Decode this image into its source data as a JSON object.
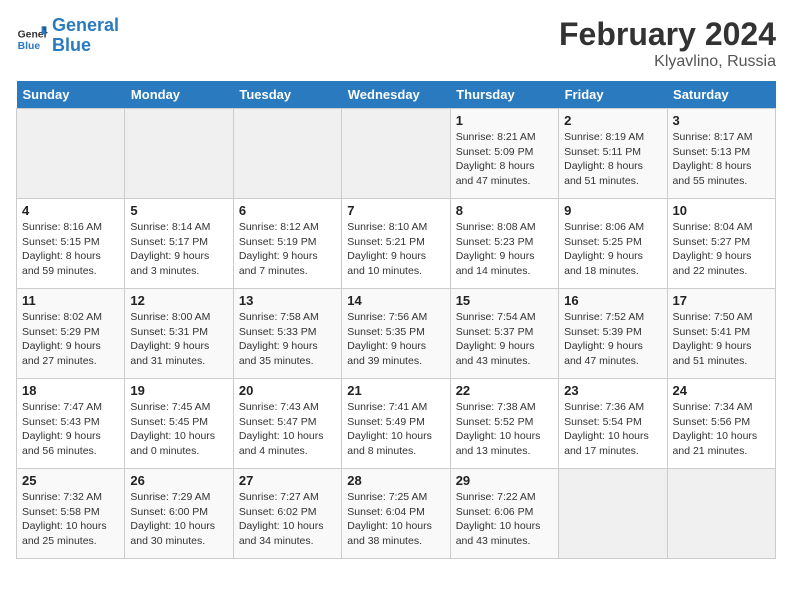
{
  "header": {
    "logo_line1": "General",
    "logo_line2": "Blue",
    "month_year": "February 2024",
    "location": "Klyavlino, Russia"
  },
  "days_of_week": [
    "Sunday",
    "Monday",
    "Tuesday",
    "Wednesday",
    "Thursday",
    "Friday",
    "Saturday"
  ],
  "weeks": [
    [
      {
        "day": "",
        "info": ""
      },
      {
        "day": "",
        "info": ""
      },
      {
        "day": "",
        "info": ""
      },
      {
        "day": "",
        "info": ""
      },
      {
        "day": "1",
        "info": "Sunrise: 8:21 AM\nSunset: 5:09 PM\nDaylight: 8 hours and 47 minutes."
      },
      {
        "day": "2",
        "info": "Sunrise: 8:19 AM\nSunset: 5:11 PM\nDaylight: 8 hours and 51 minutes."
      },
      {
        "day": "3",
        "info": "Sunrise: 8:17 AM\nSunset: 5:13 PM\nDaylight: 8 hours and 55 minutes."
      }
    ],
    [
      {
        "day": "4",
        "info": "Sunrise: 8:16 AM\nSunset: 5:15 PM\nDaylight: 8 hours and 59 minutes."
      },
      {
        "day": "5",
        "info": "Sunrise: 8:14 AM\nSunset: 5:17 PM\nDaylight: 9 hours and 3 minutes."
      },
      {
        "day": "6",
        "info": "Sunrise: 8:12 AM\nSunset: 5:19 PM\nDaylight: 9 hours and 7 minutes."
      },
      {
        "day": "7",
        "info": "Sunrise: 8:10 AM\nSunset: 5:21 PM\nDaylight: 9 hours and 10 minutes."
      },
      {
        "day": "8",
        "info": "Sunrise: 8:08 AM\nSunset: 5:23 PM\nDaylight: 9 hours and 14 minutes."
      },
      {
        "day": "9",
        "info": "Sunrise: 8:06 AM\nSunset: 5:25 PM\nDaylight: 9 hours and 18 minutes."
      },
      {
        "day": "10",
        "info": "Sunrise: 8:04 AM\nSunset: 5:27 PM\nDaylight: 9 hours and 22 minutes."
      }
    ],
    [
      {
        "day": "11",
        "info": "Sunrise: 8:02 AM\nSunset: 5:29 PM\nDaylight: 9 hours and 27 minutes."
      },
      {
        "day": "12",
        "info": "Sunrise: 8:00 AM\nSunset: 5:31 PM\nDaylight: 9 hours and 31 minutes."
      },
      {
        "day": "13",
        "info": "Sunrise: 7:58 AM\nSunset: 5:33 PM\nDaylight: 9 hours and 35 minutes."
      },
      {
        "day": "14",
        "info": "Sunrise: 7:56 AM\nSunset: 5:35 PM\nDaylight: 9 hours and 39 minutes."
      },
      {
        "day": "15",
        "info": "Sunrise: 7:54 AM\nSunset: 5:37 PM\nDaylight: 9 hours and 43 minutes."
      },
      {
        "day": "16",
        "info": "Sunrise: 7:52 AM\nSunset: 5:39 PM\nDaylight: 9 hours and 47 minutes."
      },
      {
        "day": "17",
        "info": "Sunrise: 7:50 AM\nSunset: 5:41 PM\nDaylight: 9 hours and 51 minutes."
      }
    ],
    [
      {
        "day": "18",
        "info": "Sunrise: 7:47 AM\nSunset: 5:43 PM\nDaylight: 9 hours and 56 minutes."
      },
      {
        "day": "19",
        "info": "Sunrise: 7:45 AM\nSunset: 5:45 PM\nDaylight: 10 hours and 0 minutes."
      },
      {
        "day": "20",
        "info": "Sunrise: 7:43 AM\nSunset: 5:47 PM\nDaylight: 10 hours and 4 minutes."
      },
      {
        "day": "21",
        "info": "Sunrise: 7:41 AM\nSunset: 5:49 PM\nDaylight: 10 hours and 8 minutes."
      },
      {
        "day": "22",
        "info": "Sunrise: 7:38 AM\nSunset: 5:52 PM\nDaylight: 10 hours and 13 minutes."
      },
      {
        "day": "23",
        "info": "Sunrise: 7:36 AM\nSunset: 5:54 PM\nDaylight: 10 hours and 17 minutes."
      },
      {
        "day": "24",
        "info": "Sunrise: 7:34 AM\nSunset: 5:56 PM\nDaylight: 10 hours and 21 minutes."
      }
    ],
    [
      {
        "day": "25",
        "info": "Sunrise: 7:32 AM\nSunset: 5:58 PM\nDaylight: 10 hours and 25 minutes."
      },
      {
        "day": "26",
        "info": "Sunrise: 7:29 AM\nSunset: 6:00 PM\nDaylight: 10 hours and 30 minutes."
      },
      {
        "day": "27",
        "info": "Sunrise: 7:27 AM\nSunset: 6:02 PM\nDaylight: 10 hours and 34 minutes."
      },
      {
        "day": "28",
        "info": "Sunrise: 7:25 AM\nSunset: 6:04 PM\nDaylight: 10 hours and 38 minutes."
      },
      {
        "day": "29",
        "info": "Sunrise: 7:22 AM\nSunset: 6:06 PM\nDaylight: 10 hours and 43 minutes."
      },
      {
        "day": "",
        "info": ""
      },
      {
        "day": "",
        "info": ""
      }
    ]
  ]
}
